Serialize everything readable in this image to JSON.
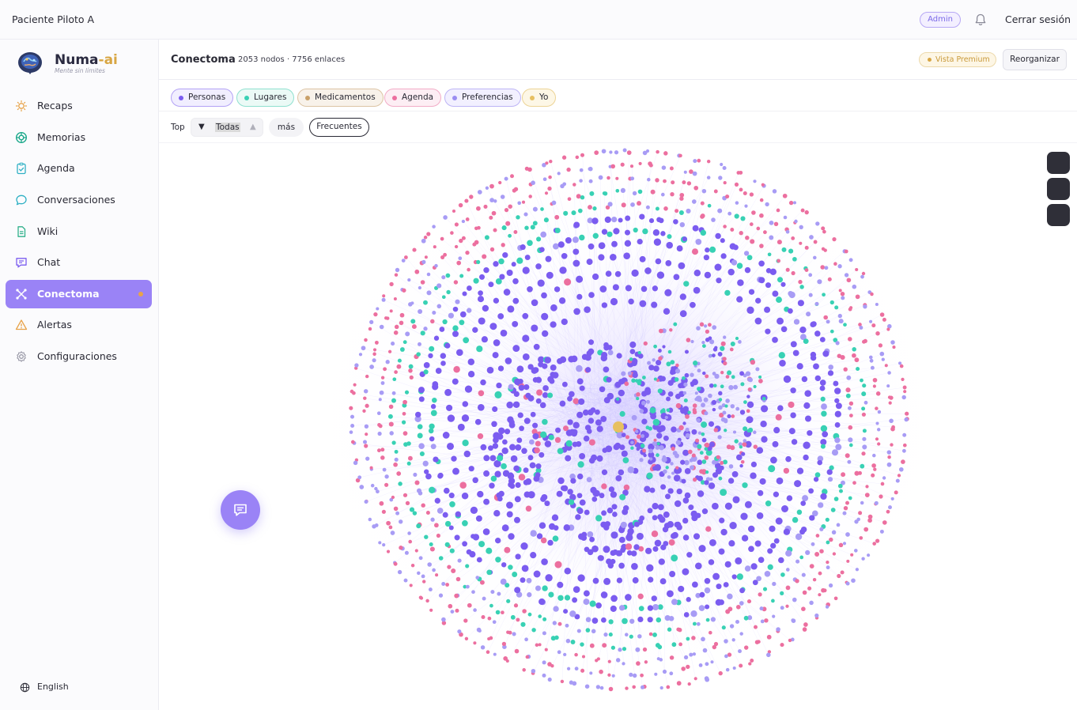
{
  "topbar": {
    "patient_name": "Paciente Piloto A",
    "admin_badge": "Admin",
    "logout_label": "Cerrar sesión",
    "accent_color": "#9a83f6"
  },
  "sidebar": {
    "brand_name": "Numa",
    "brand_suffix": "-ai",
    "tagline": "Mente sin límites",
    "items": [
      {
        "label": "Recaps",
        "icon": "lightbulb-icon"
      },
      {
        "label": "Memorias",
        "icon": "brain-circle-icon"
      },
      {
        "label": "Agenda",
        "icon": "clipboard-check-icon"
      },
      {
        "label": "Conversaciones",
        "icon": "speech-bubble-icon"
      },
      {
        "label": "Wiki",
        "icon": "document-icon"
      },
      {
        "label": "Chat",
        "icon": "message-square-icon"
      },
      {
        "label": "Conectoma",
        "icon": "network-x-icon",
        "active": true
      },
      {
        "label": "Alertas",
        "icon": "warning-triangle-icon"
      },
      {
        "label": "Configuraciones",
        "icon": "gear-icon"
      }
    ],
    "language": "English"
  },
  "header": {
    "title": "Conectoma",
    "stats": "2053 nodos · 7756 enlaces",
    "premium_label": "Vista Premium",
    "reorganize_label": "Reorganizar"
  },
  "filters": {
    "chips": [
      {
        "label": "Personas",
        "color": "#7b5cf0"
      },
      {
        "label": "Lugares",
        "color": "#38d1b4"
      },
      {
        "label": "Medicamentos",
        "color": "#c9a069"
      },
      {
        "label": "Agenda",
        "color": "#ec6f9f"
      },
      {
        "label": "Preferencias",
        "color": "#9b8ef2"
      },
      {
        "label": "Yo",
        "color": "#e7c061"
      }
    ]
  },
  "top_control": {
    "label": "Top",
    "value": "Todas",
    "more_label": "más",
    "frequent_label": "Frecuentes"
  },
  "graph": {
    "node_count": 2053,
    "link_count": 7756,
    "colors": {
      "persona": "#7b5cf0",
      "lugar": "#38d1b4",
      "medicamento": "#c9a069",
      "agenda": "#ec6f9f",
      "preferencia": "#a89cf5",
      "yo": "#e7c061"
    }
  }
}
